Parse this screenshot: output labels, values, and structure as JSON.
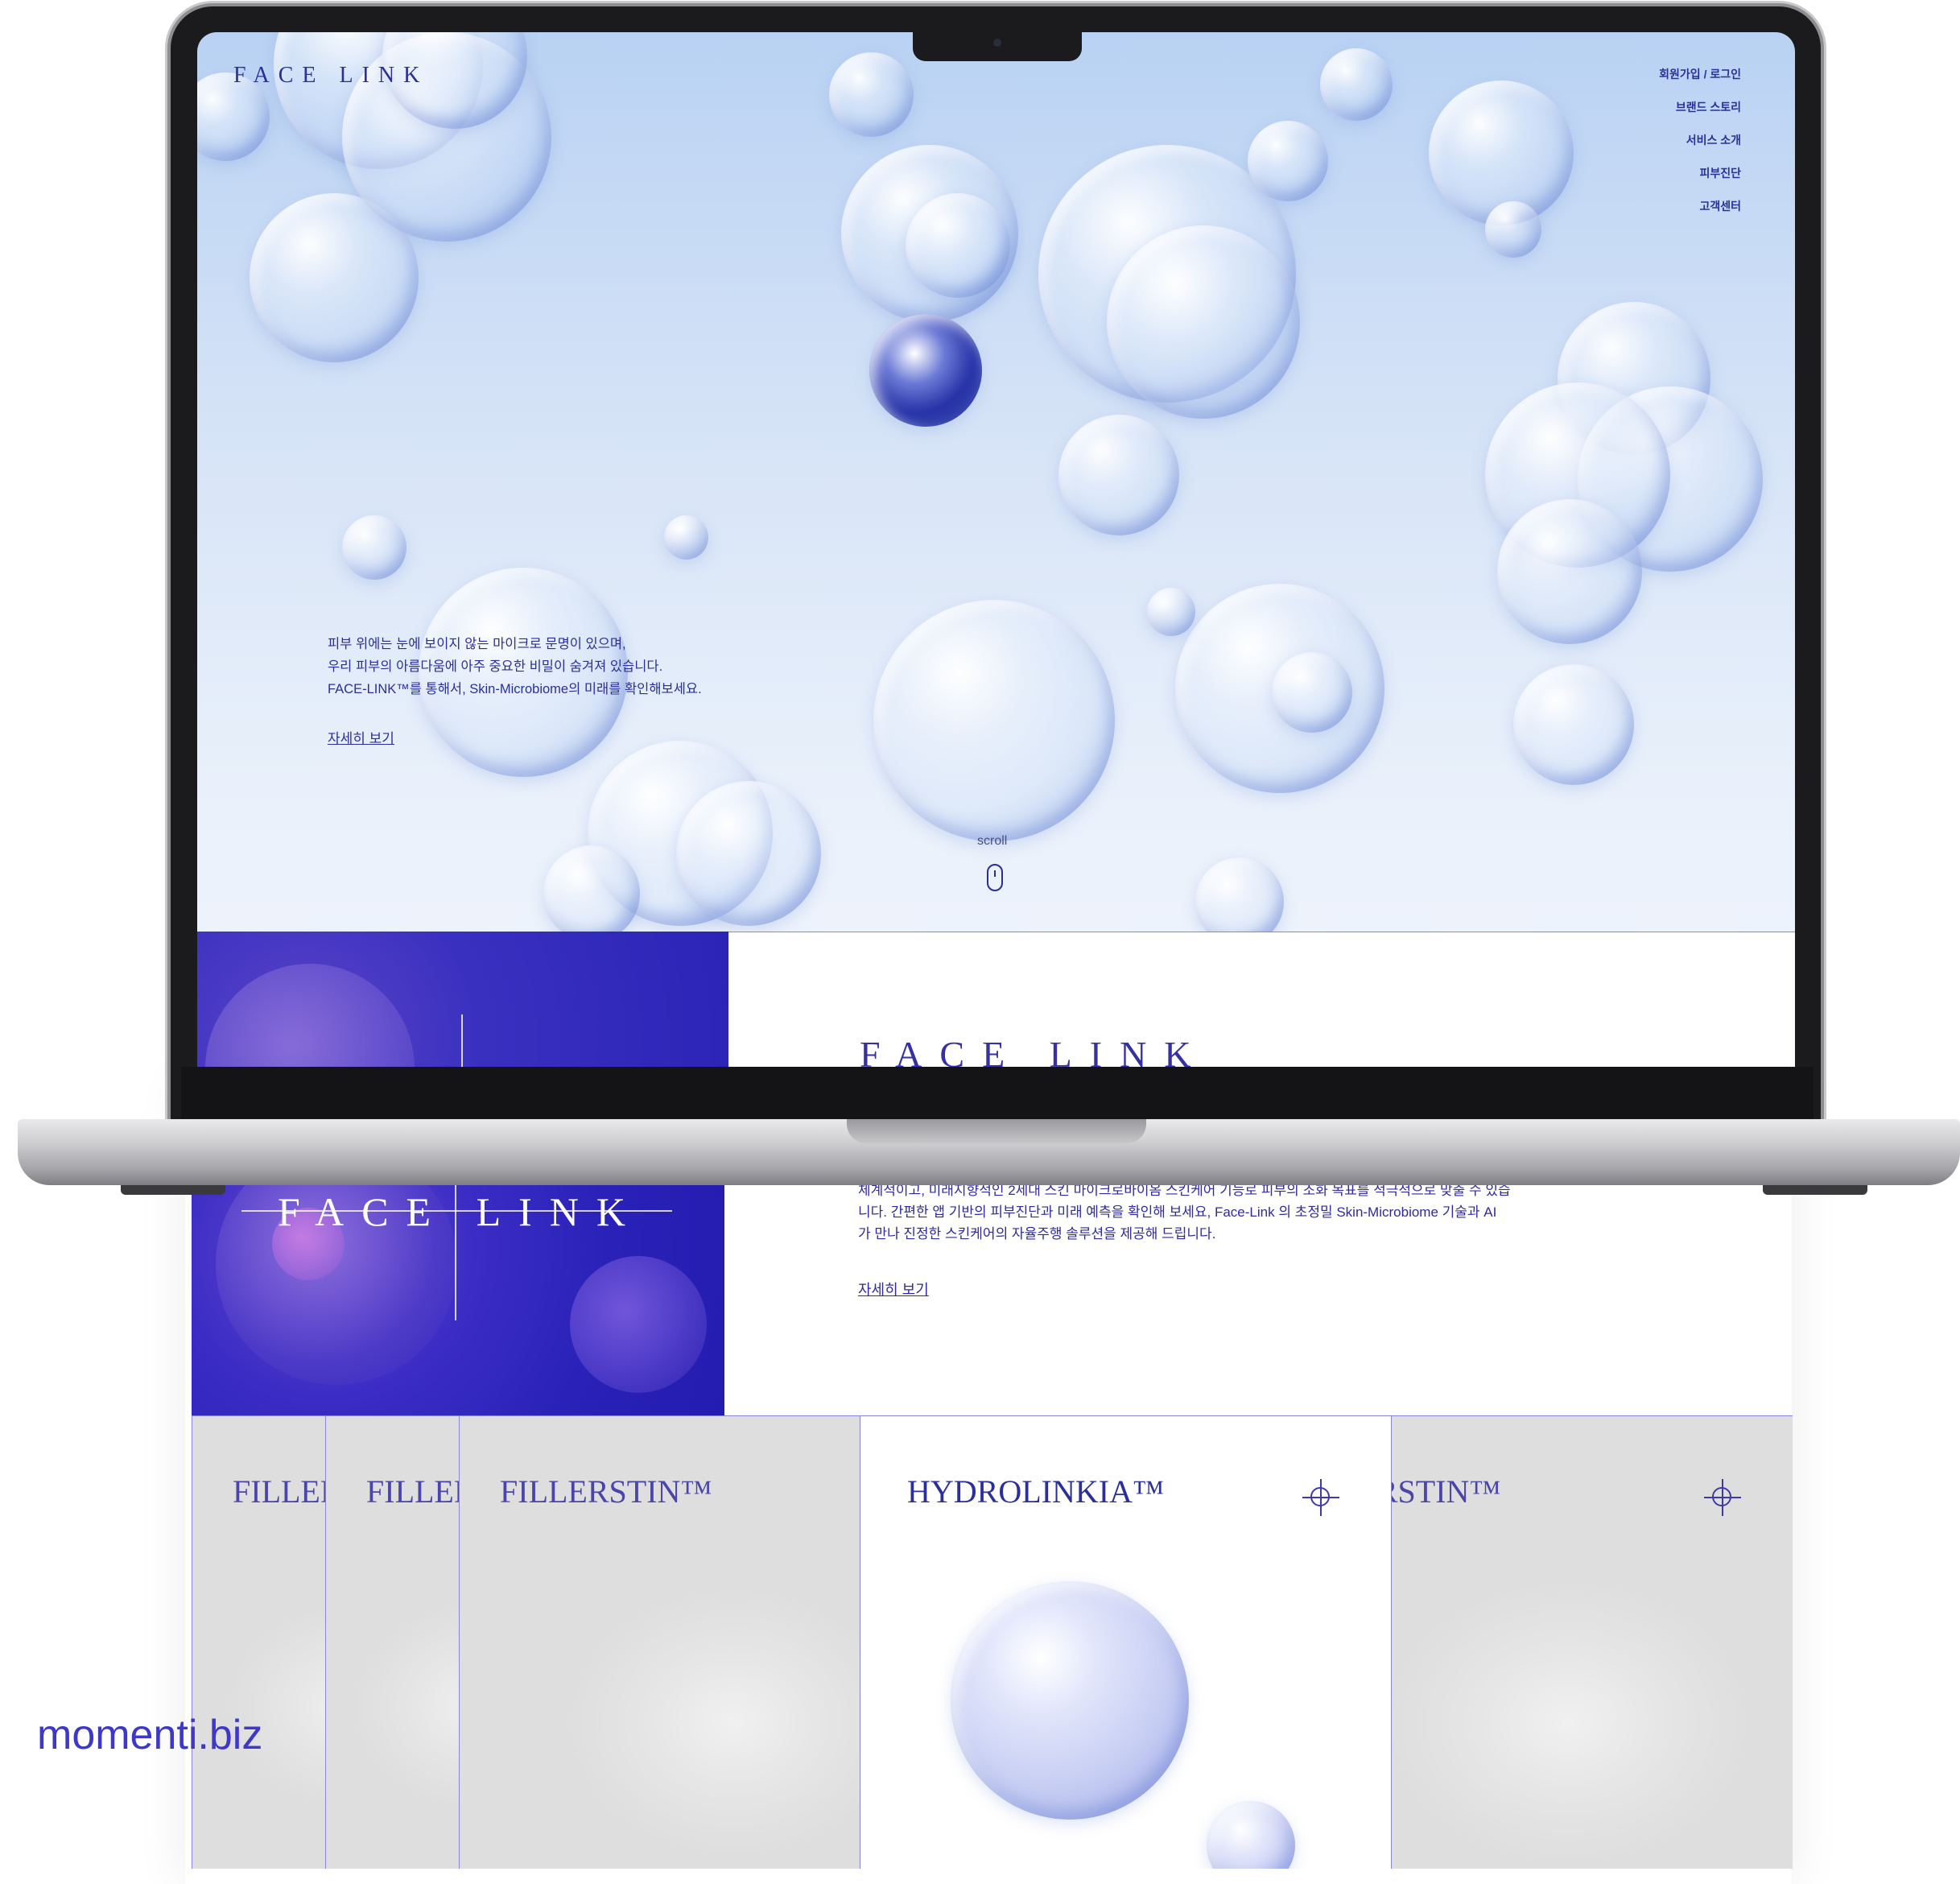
{
  "site": {
    "brand": "FACE LINK",
    "nav": [
      "회원가입 / 로그인",
      "브랜드 스토리",
      "서비스 소개",
      "피부진단",
      "고객센터"
    ]
  },
  "hero": {
    "lines": [
      "피부 위에는 눈에 보이지 않는 마이크로 문명이 있으며,",
      "우리 피부의 아름다움에 아주 중요한 비밀이 숨겨져 있습니다.",
      "FACE-LINK™를 통해서, Skin-Microbiome의 미래를 확인해보세요."
    ],
    "more_link": "자세히 보기",
    "scroll_label": "scroll"
  },
  "section2": {
    "brand": "FACE LINK",
    "lines": [
      "체계적이고, 미래지향적인 2세대 스킨 마이크로바이옴 스킨케어 기능로 피부의 조화 목표를 적극적으로 맞출 수 있습",
      "니다.  간편한 앱 기반의 피부진단과 미래 예측을 확인해 보세요, Face-Link 의 초정밀 Skin-Microbiome 기술과 AI",
      "가 만나 진정한 스킨케어의 자율주행 솔루션을 제공해 드립니다."
    ],
    "more_link": "자세히 보기"
  },
  "products": [
    {
      "name": "FILLERSTIN™"
    },
    {
      "name": "FILLERSTIN™"
    },
    {
      "name": "FILLERSTIN™"
    },
    {
      "name": "HYDROLINKIA™"
    },
    {
      "name": "FILLERSTIN™"
    }
  ],
  "watermark": "momenti.biz",
  "colors": {
    "accent": "#2b2f9a",
    "deep_blue": "#2a22b8",
    "panel_gray": "#dedede"
  }
}
